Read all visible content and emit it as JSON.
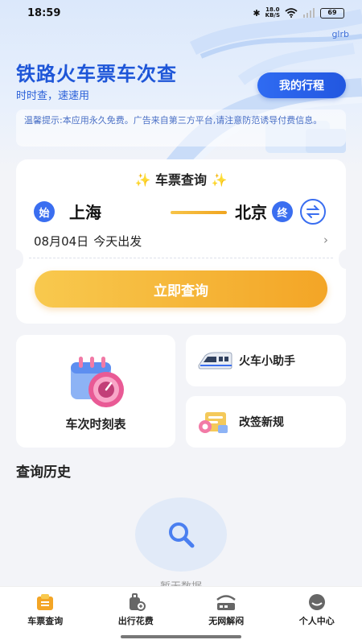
{
  "status_bar": {
    "time": "18:59",
    "speed_value": "18.0",
    "speed_unit": "KB/S",
    "battery": "69"
  },
  "header": {
    "corner_tag": "glrb",
    "title": "铁路火车票车次查",
    "subtitle": "时时查，速速用",
    "trip_button": "我的行程",
    "notice": "温馨提示:本应用永久免费。广告来自第三方平台,请注意防范诱导付费信息。"
  },
  "ticket_search": {
    "title": "车票查询",
    "from_badge": "始",
    "from_city": "上海",
    "to_badge": "终",
    "to_city": "北京",
    "date": "08月04日",
    "date_note": "今天出发",
    "search_button": "立即查询"
  },
  "shortcuts": {
    "timetable": "车次时刻表",
    "assistant": "火车小助手",
    "rebooking": "改签新规"
  },
  "history": {
    "title": "查询历史",
    "empty_text": "暂无数据"
  },
  "tabbar": {
    "tabs": [
      {
        "label": "车票查询",
        "icon": "ticket-icon"
      },
      {
        "label": "出行花费",
        "icon": "luggage-icon"
      },
      {
        "label": "无网解闷",
        "icon": "no-network-icon"
      },
      {
        "label": "个人中心",
        "icon": "profile-icon"
      }
    ]
  },
  "colors": {
    "primary": "#2f6bf2",
    "accent": "#f3a526",
    "background": "#f3f4f8"
  }
}
